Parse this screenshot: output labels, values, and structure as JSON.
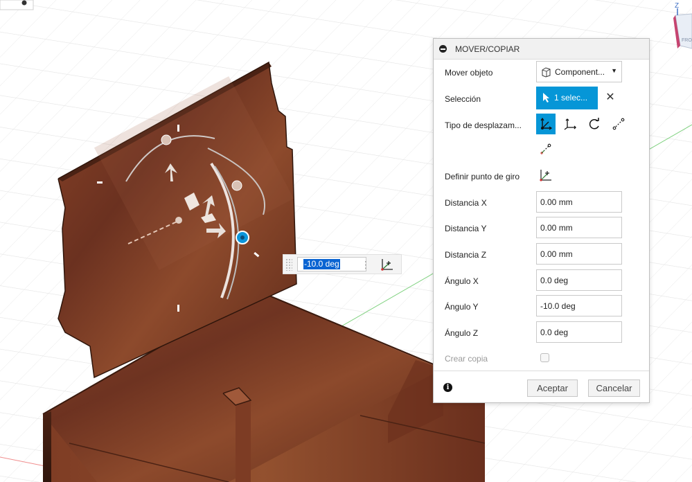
{
  "float_input": {
    "value": "-10.0 deg"
  },
  "dialog": {
    "title": "MOVER/COPIAR",
    "mover_objeto": {
      "label": "Mover objeto",
      "value": "Component..."
    },
    "seleccion": {
      "label": "Selección",
      "value": "1 selec..."
    },
    "tipo": {
      "label": "Tipo de desplazam..."
    },
    "punto_giro": {
      "label": "Definir punto de giro"
    },
    "fields": [
      {
        "label": "Distancia X",
        "value": "0.00 mm"
      },
      {
        "label": "Distancia Y",
        "value": "0.00 mm"
      },
      {
        "label": "Distancia Z",
        "value": "0.00 mm"
      },
      {
        "label": "Ángulo X",
        "value": "0.0 deg"
      },
      {
        "label": "Ángulo Y",
        "value": "-10.0 deg"
      },
      {
        "label": "Ángulo Z",
        "value": "0.0 deg"
      }
    ],
    "crear_copia": {
      "label": "Crear copia",
      "checked": false
    },
    "ok_label": "Aceptar",
    "cancel_label": "Cancelar"
  },
  "viewcube": {
    "axis_label": "Z"
  },
  "colors": {
    "accent": "#0696d7",
    "wood": "#7a3a22",
    "grid": "#e6e6e6"
  }
}
